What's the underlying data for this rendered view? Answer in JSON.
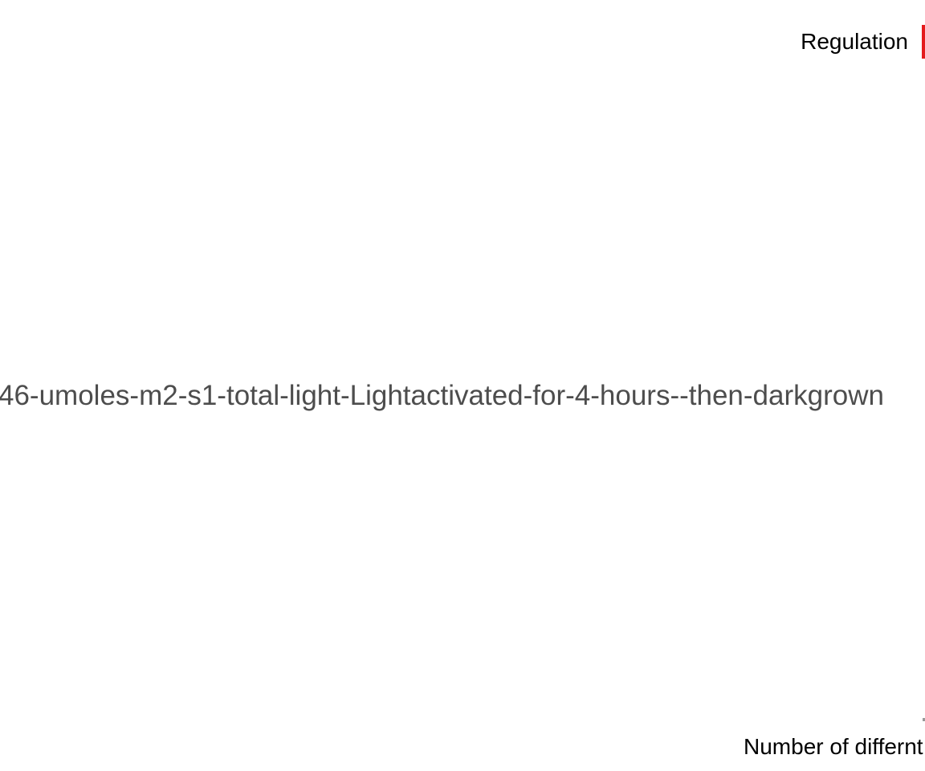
{
  "chart_data": {
    "type": "bar",
    "category_label": "46-umoles-m2-s1-total-light-Lightactivated-for-4-hours--then-darkgrown",
    "legend": {
      "title": "Regulation",
      "placement": "top-right",
      "entries": [
        {
          "label": "",
          "color": "#e41a1c"
        }
      ]
    },
    "xlabel": "Number of differnt",
    "colors": {
      "category_text": "#4d4d4d",
      "legend_text": "#000000",
      "axis_label_text": "#000000"
    }
  }
}
